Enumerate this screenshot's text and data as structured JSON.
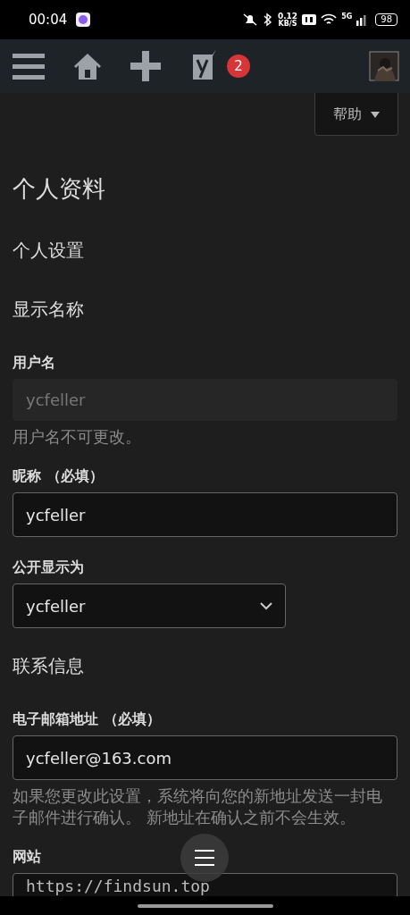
{
  "status_bar": {
    "time": "00:04",
    "network_speed": "0.12",
    "speed_unit": "KB/S",
    "network_type": "5G",
    "battery": "98"
  },
  "admin_bar": {
    "notification_count": "2"
  },
  "help_button": {
    "label": "帮助"
  },
  "page_title": "个人资料",
  "items": [
    {
      "kind": "section",
      "text": "个人设置"
    },
    {
      "kind": "section",
      "text": "显示名称"
    },
    {
      "kind": "text",
      "label": "用户名",
      "value": "ycfeller",
      "disabled": true,
      "note": "用户名不可更改。"
    },
    {
      "kind": "text",
      "label": "昵称 （必填）",
      "value": "ycfeller",
      "disabled": false
    },
    {
      "kind": "select",
      "label": "公开显示为",
      "value": "ycfeller"
    },
    {
      "kind": "section",
      "text": "联系信息"
    },
    {
      "kind": "text",
      "label": "电子邮箱地址 （必填）",
      "value": "ycfeller@163.com",
      "disabled": false,
      "note": "如果您更改此设置，系统将向您的新地址发送一封电子邮件进行确认。 新地址在确认之前不会生效。"
    },
    {
      "kind": "url",
      "label": "网站",
      "value": "https://findsun.top",
      "disabled": false
    }
  ]
}
